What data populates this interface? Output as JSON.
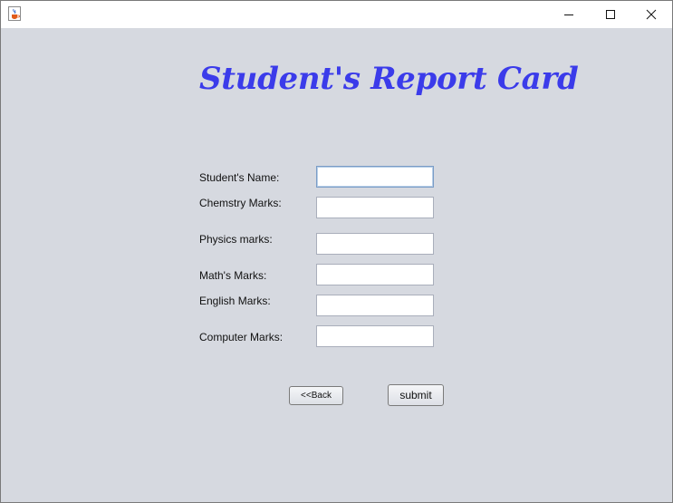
{
  "window": {
    "controls": {
      "minimize_icon": "minimize-icon",
      "maximize_icon": "maximize-icon",
      "close_icon": "close-icon"
    },
    "app_icon": "java-cup-icon"
  },
  "form": {
    "title": "Student's Report Card",
    "fields": [
      {
        "label": "Student's Name:",
        "value": ""
      },
      {
        "label": "Chemstry Marks:",
        "value": ""
      },
      {
        "label": "Physics marks:",
        "value": ""
      },
      {
        "label": "Math's Marks:",
        "value": ""
      },
      {
        "label": "English Marks:",
        "value": ""
      },
      {
        "label": "Computer Marks:",
        "value": ""
      }
    ],
    "back_label": "<<Back",
    "submit_label": "submit"
  },
  "colors": {
    "title": "#3b3bea",
    "background": "#d6d9e0"
  }
}
